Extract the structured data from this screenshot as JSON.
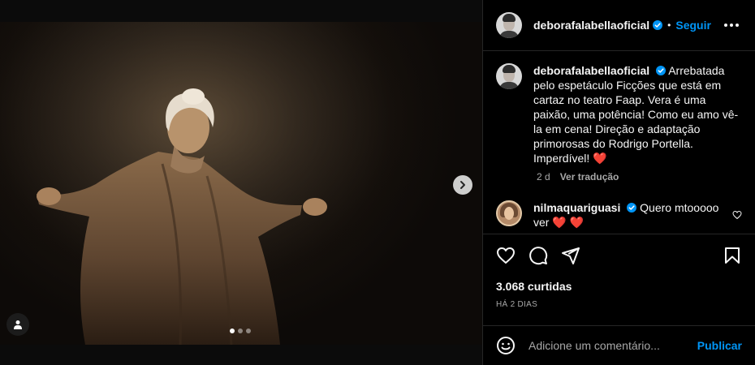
{
  "post": {
    "username": "deborafalabellaoficial",
    "separator": "•",
    "follow_label": "Seguir",
    "caption": "Arrebatada pelo espetáculo Ficções que está em cartaz no teatro Faap. Vera é uma paixão, uma potência! Como eu amo vê-la em cena! Direção e adaptação primorosas do Rodrigo Portella. Imperdível!",
    "caption_emoji": "❤️",
    "caption_age": "2 d",
    "translate_label": "Ver tradução"
  },
  "comment": {
    "username": "nilmaquariguasi",
    "text": "Quero mtooooo ver",
    "emoji": "❤️ ❤️"
  },
  "stats": {
    "likes": "3.068 curtidas",
    "date": "HÁ 2 DIAS"
  },
  "add_comment": {
    "placeholder": "Adicione um comentário...",
    "publish_label": "Publicar"
  },
  "carousel": {
    "total": 3,
    "active": 1
  },
  "colors": {
    "accent": "#0095f6",
    "heart": "#ed4956",
    "background": "#000000"
  }
}
